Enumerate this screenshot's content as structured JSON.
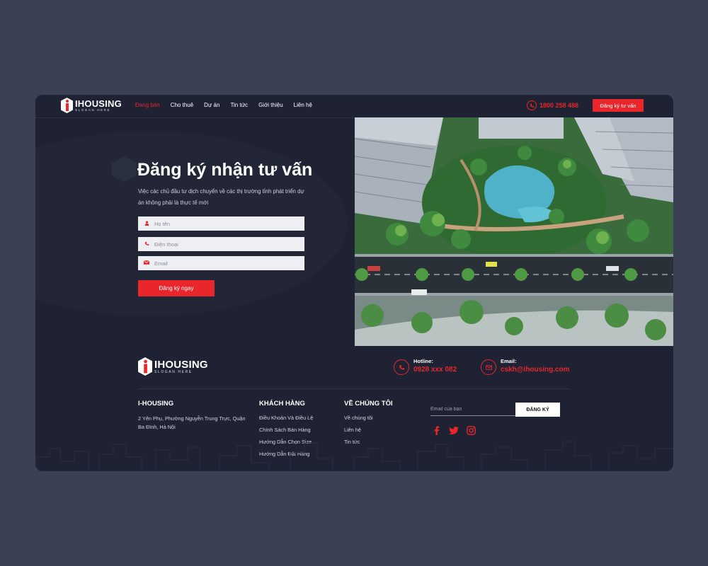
{
  "colors": {
    "accent": "#e8262b",
    "background": "#1e2233",
    "page_background": "#3b4052"
  },
  "brand": {
    "name": "IHOUSING",
    "slogan": "SLOGAN HERE",
    "logo_icon": "hexagon-i-logo-icon"
  },
  "nav": {
    "items": [
      {
        "label": "Đang bán",
        "active": true
      },
      {
        "label": "Cho thuê"
      },
      {
        "label": "Dự án"
      },
      {
        "label": "Tin tức"
      },
      {
        "label": "Giới thiệu"
      },
      {
        "label": "Liên hệ"
      }
    ]
  },
  "header": {
    "phone": "1800 258 488",
    "phone_icon": "phone-icon",
    "consult_button": "Đăng ký tư vấn"
  },
  "hero": {
    "title": "Đăng ký nhận tư vấn",
    "description": "Việc các chủ đầu tư dịch chuyển về các thị trường tỉnh phát triển dự án không phải là thực tế mới",
    "form": {
      "name_placeholder": "Họ tên",
      "phone_placeholder": "Điện thoại",
      "email_placeholder": "Email",
      "submit": "Đăng ký ngay"
    },
    "image": "aerial-residential-complex-photo"
  },
  "footer": {
    "hotline_label": "Hotline:",
    "hotline": "0928 xxx 082",
    "email_label": "Email:",
    "email": "cskh@ihousing.com",
    "company": {
      "title": "I-HOUSING",
      "address": "2 Yên Phụ, Phường Nguyễn Trung Trực, Quận Ba Đình, Hà Nội"
    },
    "customers": {
      "title": "KHÁCH HÀNG",
      "links": [
        "Điều Khoản Và Điều Lệ",
        "Chính Sách Bán Hàng",
        "Hướng Dẫn Chọn Size",
        "Hướng Dẫn Đặt Hàng"
      ]
    },
    "about": {
      "title": "VỀ CHÚNG TÔI",
      "links": [
        "Về chúng tôi",
        "Liên hệ",
        "Tin tức"
      ]
    },
    "newsletter": {
      "placeholder": "Email của bạn",
      "button": "ĐĂNG KÝ"
    },
    "socials": [
      "facebook-icon",
      "twitter-icon",
      "instagram-icon"
    ]
  }
}
